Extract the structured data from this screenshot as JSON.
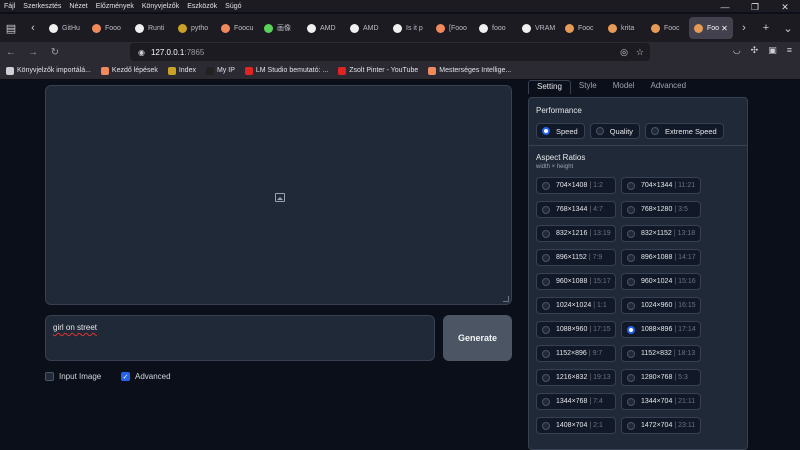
{
  "menu": [
    "Fájl",
    "Szerkesztés",
    "Nézet",
    "Előzmények",
    "Könyvjelzők",
    "Eszközök",
    "Súgó"
  ],
  "window_controls": [
    "—",
    "❐",
    "✕"
  ],
  "tabs": [
    {
      "label": "GitHu",
      "color": "#f0f0f0"
    },
    {
      "label": "Fooo",
      "color": "#f08a5d"
    },
    {
      "label": "Runti",
      "color": "#f0f0f0"
    },
    {
      "label": "pytho",
      "color": "#c9a227"
    },
    {
      "label": "Foocu",
      "color": "#f08a5d"
    },
    {
      "label": "画像",
      "color": "#5ad35a"
    },
    {
      "label": "AMD",
      "color": "#f0f0f0"
    },
    {
      "label": "AMD",
      "color": "#f0f0f0"
    },
    {
      "label": "Is it p",
      "color": "#f0f0f0"
    },
    {
      "label": "[Fooo",
      "color": "#f08a5d"
    },
    {
      "label": "fooo",
      "color": "#f0f0f0"
    },
    {
      "label": "VRAM",
      "color": "#f0f0f0"
    },
    {
      "label": "Fooc",
      "color": "#e59b55"
    },
    {
      "label": "krita",
      "color": "#e59b55"
    },
    {
      "label": "Fooc",
      "color": "#e59b55"
    },
    {
      "label": "Foo",
      "color": "#e59b55",
      "active": true
    }
  ],
  "url": {
    "host": "127.0.0.1",
    "port": ":7865"
  },
  "bookmarks": [
    {
      "label": "Könyvjelzők importálá...",
      "color": "#cfcfd6"
    },
    {
      "label": "Kezdő lépések",
      "color": "#f08a5d"
    },
    {
      "label": "Index",
      "color": "#c9a227"
    },
    {
      "label": "My IP",
      "color": "#222"
    },
    {
      "label": "LM Studio bemutató: ...",
      "color": "#e02424"
    },
    {
      "label": "Zsolt Pinter - YouTube",
      "color": "#e02424"
    },
    {
      "label": "Mesterséges Intellige...",
      "color": "#f08a5d"
    }
  ],
  "prompt": {
    "value": "girl on street"
  },
  "generate_label": "Generate",
  "checks": [
    {
      "label": "Input Image",
      "checked": false
    },
    {
      "label": "Advanced",
      "checked": true
    }
  ],
  "right_tabs": [
    "Setting",
    "Style",
    "Model",
    "Advanced"
  ],
  "performance": {
    "title": "Performance",
    "options": [
      {
        "label": "Speed",
        "selected": true
      },
      {
        "label": "Quality",
        "selected": false
      },
      {
        "label": "Extreme Speed",
        "selected": false
      }
    ]
  },
  "aspect": {
    "title": "Aspect Ratios",
    "subtitle": "width × height",
    "selected": "1088×896",
    "options": [
      {
        "size": "704×1408",
        "ratio": "1:2"
      },
      {
        "size": "704×1344",
        "ratio": "11:21"
      },
      {
        "size": "768×1344",
        "ratio": "4:7"
      },
      {
        "size": "768×1280",
        "ratio": "3:5"
      },
      {
        "size": "832×1216",
        "ratio": "13:19"
      },
      {
        "size": "832×1152",
        "ratio": "13:18"
      },
      {
        "size": "896×1152",
        "ratio": "7:9"
      },
      {
        "size": "896×1088",
        "ratio": "14:17"
      },
      {
        "size": "960×1088",
        "ratio": "15:17"
      },
      {
        "size": "960×1024",
        "ratio": "15:16"
      },
      {
        "size": "1024×1024",
        "ratio": "1:1"
      },
      {
        "size": "1024×960",
        "ratio": "16:15"
      },
      {
        "size": "1088×960",
        "ratio": "17:15"
      },
      {
        "size": "1088×896",
        "ratio": "17:14"
      },
      {
        "size": "1152×896",
        "ratio": "9:7"
      },
      {
        "size": "1152×832",
        "ratio": "18:13"
      },
      {
        "size": "1216×832",
        "ratio": "19:13"
      },
      {
        "size": "1280×768",
        "ratio": "5:3"
      },
      {
        "size": "1344×768",
        "ratio": "7:4"
      },
      {
        "size": "1344×704",
        "ratio": "21:11"
      },
      {
        "size": "1408×704",
        "ratio": "2:1"
      },
      {
        "size": "1472×704",
        "ratio": "23:11"
      }
    ]
  }
}
